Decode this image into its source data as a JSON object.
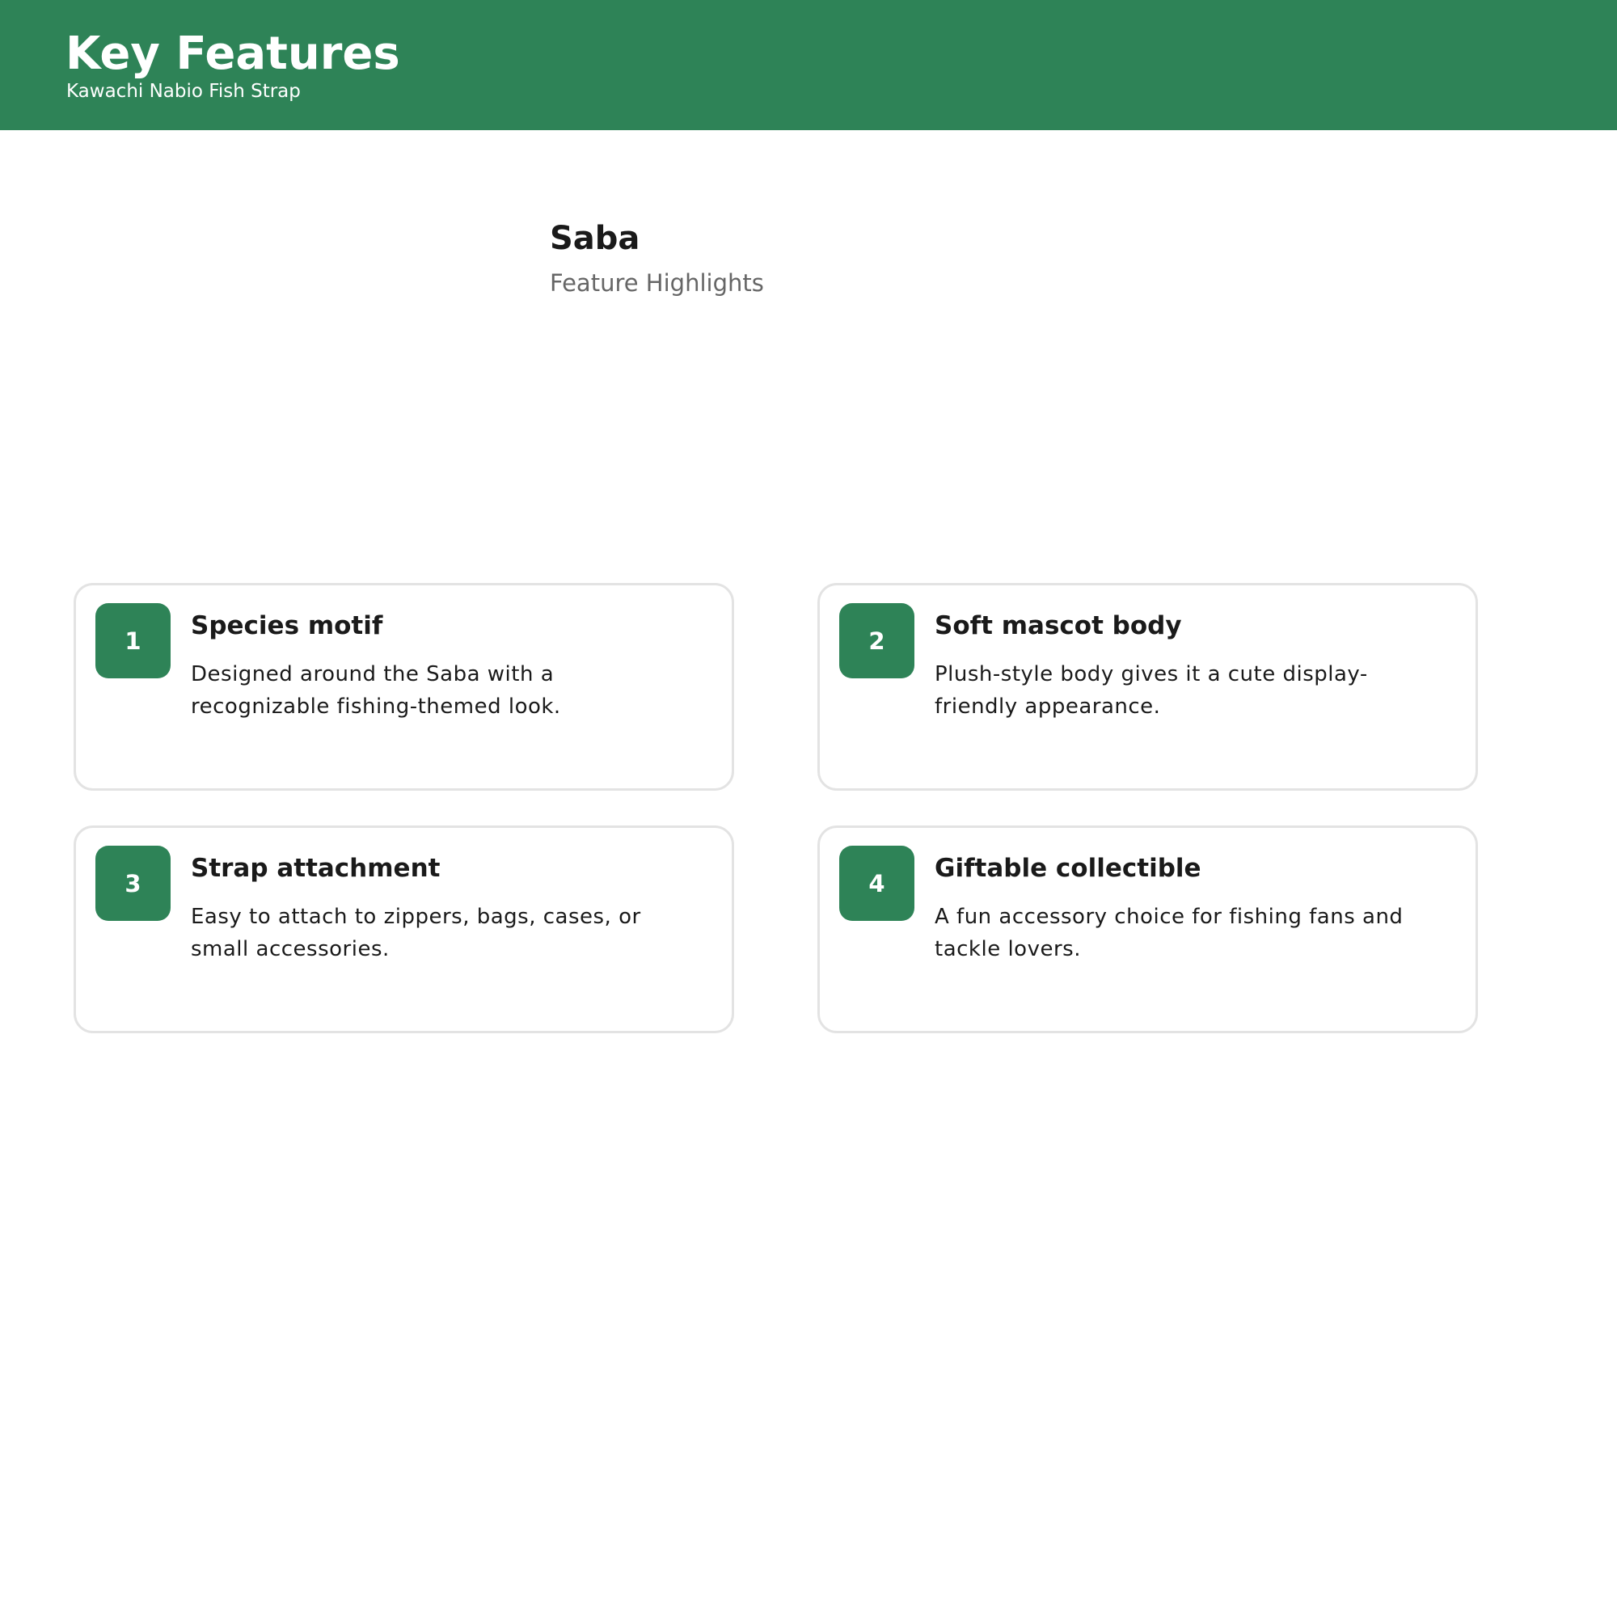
{
  "header": {
    "title": "Key Features",
    "subtitle": "Kawachi Nabio Fish Strap"
  },
  "product": {
    "name": "Saba",
    "section_label": "Feature Highlights"
  },
  "features": [
    {
      "number": "1",
      "title": "Species motif",
      "description": "Designed around the Saba with a recognizable fishing-themed look."
    },
    {
      "number": "2",
      "title": "Soft mascot body",
      "description": "Plush-style body gives it a cute display-friendly appearance."
    },
    {
      "number": "3",
      "title": "Strap attachment",
      "description": "Easy to attach to zippers, bags, cases, or small accessories."
    },
    {
      "number": "4",
      "title": "Giftable collectible",
      "description": "A fun accessory choice for fishing fans and tackle lovers."
    }
  ],
  "colors": {
    "accent": "#2e8357",
    "card_border": "#e3e3e3",
    "muted_text": "#666666"
  }
}
